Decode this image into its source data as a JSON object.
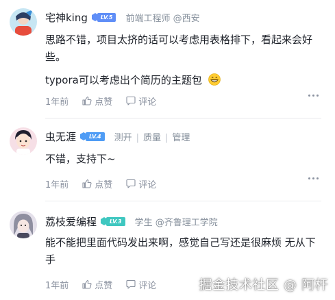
{
  "comments": [
    {
      "username": "宅神king",
      "level": "LV.5",
      "level_color": "#5f8ef7",
      "title_parts": [
        "前端工程师 @西安"
      ],
      "content_lines": [
        "思路不错，项目太挤的话可以考虑用表格排下，看起来会好些。",
        "typora可以考虑出个简历的主题包"
      ],
      "time": "1年前",
      "like_label": "点赞",
      "comment_label": "评论"
    },
    {
      "username": "虫无涯",
      "level": "LV.4",
      "level_color": "#4f9cf5",
      "title_parts": [
        "测开",
        "质量",
        "管理"
      ],
      "content_lines": [
        "不错，支持下~"
      ],
      "time": "1年前",
      "like_label": "点赞",
      "comment_label": "评论"
    },
    {
      "username": "荔枝爱编程",
      "level": "LV.3",
      "level_color": "#3fc7c0",
      "title_parts": [
        "学生 @齐鲁理工学院"
      ],
      "content_lines": [
        "能不能把里面代码发出来啊，感觉自己写还是很麻烦 无从下手"
      ],
      "time": "1年前",
      "like_label": "点赞",
      "comment_label": "评论"
    }
  ],
  "watermark": "掘金技术社区 @ 阿杆",
  "icons": {
    "like": "thumb-up-icon",
    "comment": "speech-bubble-icon",
    "more": "more-dots-icon",
    "emoji": "grinning-face-icon",
    "level": "level-badge-icon"
  }
}
